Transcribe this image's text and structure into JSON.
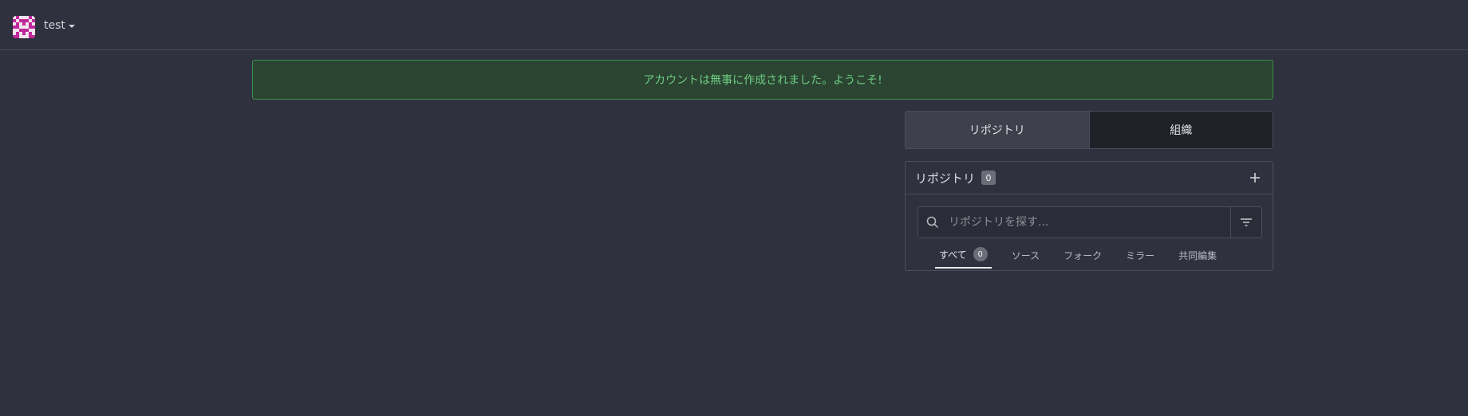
{
  "user": {
    "name": "test",
    "avatar_color": "#c0289a"
  },
  "flash": {
    "message": "アカウントは無事に作成されました。ようこそ!"
  },
  "dashboard_tabs": [
    {
      "label": "リポジトリ",
      "active": true
    },
    {
      "label": "組織",
      "active": false
    }
  ],
  "repo_panel": {
    "title": "リポジトリ",
    "count": "0",
    "search": {
      "placeholder": "リポジトリを探す..."
    },
    "filters": [
      {
        "label": "すべて",
        "count": "0",
        "active": true
      },
      {
        "label": "ソース"
      },
      {
        "label": "フォーク"
      },
      {
        "label": "ミラー"
      },
      {
        "label": "共同編集"
      }
    ]
  }
}
